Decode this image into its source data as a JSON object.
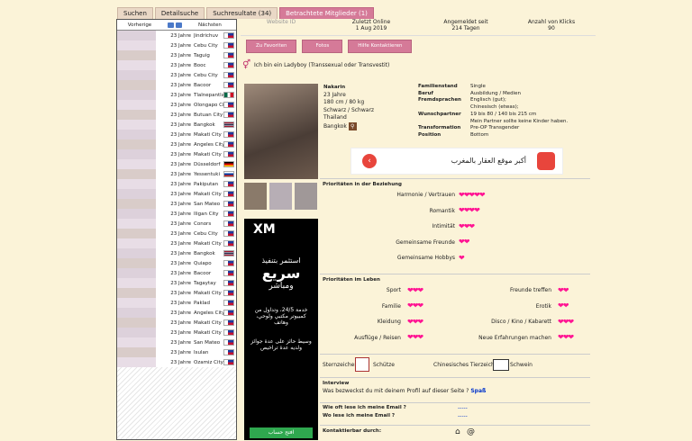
{
  "tabs": [
    "Suchen",
    "Detailsuche",
    "Suchresultate (34)",
    "Betrachtete Mitglieder (1)"
  ],
  "left": {
    "prev": "Vorherige",
    "next": "Nächsten",
    "rows": [
      {
        "age": "23 Jahre",
        "city": "Jindrichuv",
        "flag": "ph"
      },
      {
        "age": "23 Jahre",
        "city": "Cebu City",
        "flag": "ph"
      },
      {
        "age": "23 Jahre",
        "city": "Taguig",
        "flag": "ph"
      },
      {
        "age": "23 Jahre",
        "city": "Booc",
        "flag": "ph"
      },
      {
        "age": "23 Jahre",
        "city": "Cebu City",
        "flag": "ph"
      },
      {
        "age": "23 Jahre",
        "city": "Bacoor",
        "flag": "ph"
      },
      {
        "age": "23 Jahre",
        "city": "Tlalnepantla",
        "flag": "mx"
      },
      {
        "age": "23 Jahre",
        "city": "Olongapo City",
        "flag": "ph"
      },
      {
        "age": "23 Jahre",
        "city": "Butuan City",
        "flag": "ph"
      },
      {
        "age": "23 Jahre",
        "city": "Bangkok",
        "flag": "th"
      },
      {
        "age": "23 Jahre",
        "city": "Makati City",
        "flag": "ph"
      },
      {
        "age": "23 Jahre",
        "city": "Angeles City",
        "flag": "ph"
      },
      {
        "age": "23 Jahre",
        "city": "Makati City",
        "flag": "ph"
      },
      {
        "age": "23 Jahre",
        "city": "Düsseldorf",
        "flag": "de"
      },
      {
        "age": "23 Jahre",
        "city": "Yessentuki",
        "flag": "ru"
      },
      {
        "age": "23 Jahre",
        "city": "Pakiputan",
        "flag": "ph"
      },
      {
        "age": "23 Jahre",
        "city": "Makati City",
        "flag": "ph"
      },
      {
        "age": "23 Jahre",
        "city": "San Mateo",
        "flag": "ph"
      },
      {
        "age": "23 Jahre",
        "city": "Iligan City",
        "flag": "ph"
      },
      {
        "age": "23 Jahre",
        "city": "Conors",
        "flag": "ph"
      },
      {
        "age": "23 Jahre",
        "city": "Cebu City",
        "flag": "ph"
      },
      {
        "age": "23 Jahre",
        "city": "Makati City",
        "flag": "ph"
      },
      {
        "age": "23 Jahre",
        "city": "Bangkok",
        "flag": "th",
        "selected": true
      },
      {
        "age": "23 Jahre",
        "city": "Quiapo",
        "flag": "ph"
      },
      {
        "age": "23 Jahre",
        "city": "Bacoor",
        "flag": "ph"
      },
      {
        "age": "23 Jahre",
        "city": "Tagaytay",
        "flag": "ph"
      },
      {
        "age": "23 Jahre",
        "city": "Makati City",
        "flag": "ph"
      },
      {
        "age": "23 Jahre",
        "city": "Paklad",
        "flag": "ph"
      },
      {
        "age": "23 Jahre",
        "city": "Angeles City",
        "flag": "ph"
      },
      {
        "age": "23 Jahre",
        "city": "Makati City",
        "flag": "ph"
      },
      {
        "age": "23 Jahre",
        "city": "Makati City",
        "flag": "ph"
      },
      {
        "age": "23 Jahre",
        "city": "San Mateo",
        "flag": "ph"
      },
      {
        "age": "23 Jahre",
        "city": "Isulan",
        "flag": "ph"
      },
      {
        "age": "23 Jahre",
        "city": "Ozamiz City",
        "flag": "ph"
      }
    ]
  },
  "top": {
    "website": "Website ID",
    "online_label": "Zuletzt Online",
    "online_value": "1 Aug 2019",
    "registered_label": "Angemeldet seit",
    "registered_value": "214 Tagen",
    "clicks_label": "Anzahl von Klicks",
    "clicks_value": "90"
  },
  "buttons": [
    "Zu Favoriten",
    "Fotos",
    "Hilfe Kontaktieren"
  ],
  "ladyboy": "Ich bin ein Ladyboy (Transsexual oder Transvestit)",
  "profile": {
    "name": "Nakarin",
    "age": "23 Jahre",
    "size": "180 cm / 80 kg",
    "hair": "Schwarz / Schwarz",
    "country": "Thailand",
    "city": "Bangkok",
    "fields": [
      {
        "label": "Familienstand",
        "value": "Single"
      },
      {
        "label": "Beruf",
        "value": "Ausbildung / Medien"
      },
      {
        "label": "Fremdsprachen",
        "value": "Englisch (gut);\nChinesisch (etwas);"
      },
      {
        "label": "Wunschpartner",
        "value": "19 bis 80  /  140 bis 215 cm\nMein Partner sollte keine Kinder haben."
      },
      {
        "label": "Transformation",
        "value": "Pre-OP Transgender"
      },
      {
        "label": "Position",
        "value": "Bottom"
      }
    ]
  },
  "ad": {
    "text": "أكبر موقع العقار بالمغرب"
  },
  "xm": {
    "logo": "XM",
    "head": "استثمر بتنفيذ",
    "big": "سريع",
    "sub": "ومباشر",
    "p1": "خدمة 24/5، وتداول من كمبيوتر مكتبي ولوحي، وهاتف",
    "p2": "وسيط حائز على عدة جوائز ولديه عدة تراخيص",
    "cta": "افتح حساب"
  },
  "priorities_rel": {
    "title": "Prioritäten in der Beziehung",
    "items": [
      {
        "label": "Harmonie / Vertrauen",
        "hearts": 5
      },
      {
        "label": "Romantik",
        "hearts": 4
      },
      {
        "label": "Intimität",
        "hearts": 3
      },
      {
        "label": "Gemeinsame Freunde",
        "hearts": 2
      },
      {
        "label": "Gemeinsame Hobbys",
        "hearts": 1
      }
    ]
  },
  "priorities_life": {
    "title": "Prioritäten im Leben",
    "left": [
      {
        "label": "Sport",
        "hearts": 3
      },
      {
        "label": "Familie",
        "hearts": 3
      },
      {
        "label": "Kleidung",
        "hearts": 3
      },
      {
        "label": "Ausflüge / Reisen",
        "hearts": 3
      }
    ],
    "right": [
      {
        "label": "Freunde treffen",
        "hearts": 2
      },
      {
        "label": "Erotik",
        "hearts": 2
      },
      {
        "label": "Disco / Kino / Kabarett",
        "hearts": 3
      },
      {
        "label": "Neue Erfahrungen machen",
        "hearts": 3
      }
    ]
  },
  "zodiac": {
    "label": "Sternzeichen",
    "value": "Schütze",
    "chinese_label": "Chinesisches Tierzeichen",
    "chinese_value": "Schwein"
  },
  "interview": {
    "title": "Interview",
    "q": "Was bezweckst du mit deinem Profil auf dieser Seite ?",
    "a": "Spaß"
  },
  "email": {
    "q1": "Wie oft lese ich meine Email ?",
    "a1": "-----",
    "q2": "Wo lese ich meine Email ?",
    "a2": "-----"
  },
  "contact": {
    "label": "Kontaktierbar durch:"
  },
  "colors": {
    "pink": "#d57a98",
    "heart": "#ff1493",
    "bg": "#fbf3d8"
  }
}
